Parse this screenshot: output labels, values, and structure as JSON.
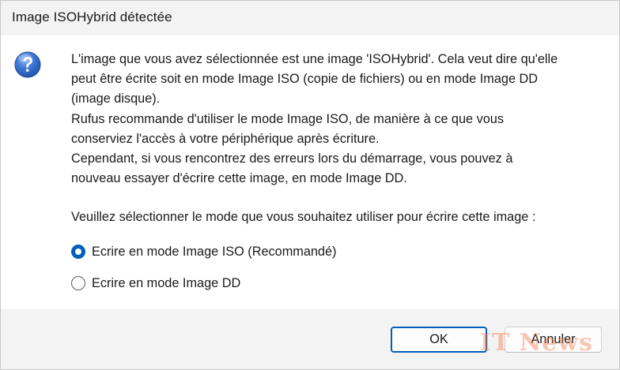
{
  "window": {
    "title": "Image ISOHybrid détectée"
  },
  "icon": {
    "name": "question-icon",
    "color": "#2f6ccf"
  },
  "message": {
    "lines": [
      "L'image que vous avez sélectionnée est une image 'ISOHybrid'. Cela veut dire qu'elle",
      "peut être écrite soit en mode Image ISO (copie de fichiers) ou en mode Image DD",
      "(image disque).",
      "Rufus recommande d'utiliser le mode Image ISO, de manière à ce que vous",
      "conserviez l'accès à votre périphérique après écriture.",
      "Cependant, si vous rencontrez des erreurs lors du démarrage, vous pouvez à",
      "nouveau essayer d'écrire cette image, en mode Image DD."
    ],
    "prompt": "Veuillez sélectionner le mode que vous souhaitez utiliser pour écrire cette image :"
  },
  "options": [
    {
      "label": "Ecrire en mode Image ISO (Recommandé)",
      "checked": true
    },
    {
      "label": "Ecrire en mode Image DD",
      "checked": false
    }
  ],
  "buttons": {
    "ok_label": "OK",
    "cancel_label": "Annuler"
  },
  "watermark": {
    "text": "IT News"
  },
  "colors": {
    "accent": "#005fb8",
    "footer_bg": "#f3f3f3",
    "content_bg": "#ffffff"
  }
}
